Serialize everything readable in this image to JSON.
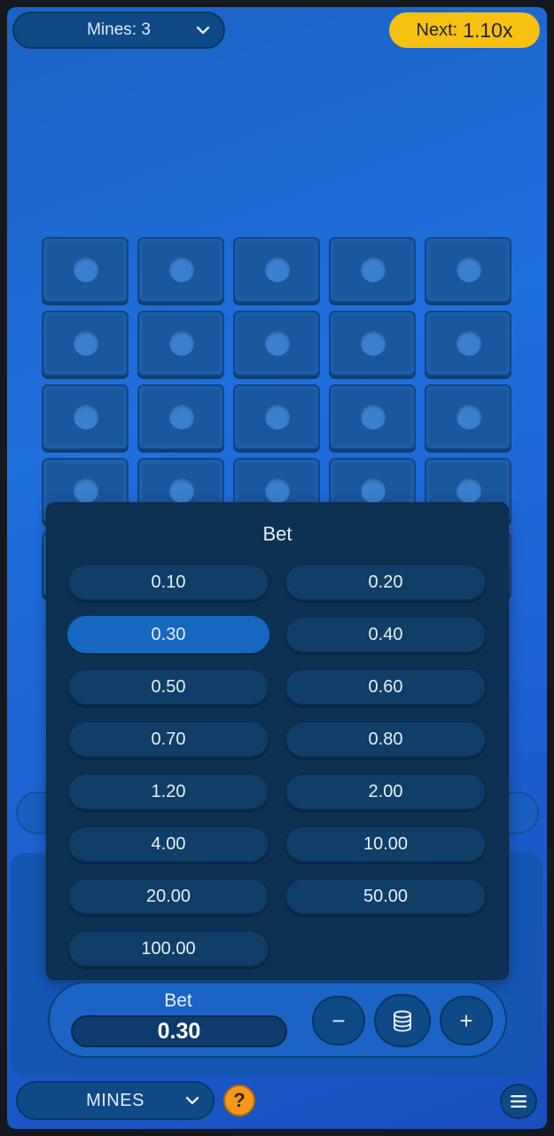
{
  "topbar": {
    "mines_label": "Mines: 3",
    "next_label": "Next:",
    "next_value": "1.10x"
  },
  "grid": {
    "rows": 5,
    "cols": 5
  },
  "bet_modal": {
    "title": "Bet",
    "options": [
      "0.10",
      "0.20",
      "0.30",
      "0.40",
      "0.50",
      "0.60",
      "0.70",
      "0.80",
      "1.20",
      "2.00",
      "4.00",
      "10.00",
      "20.00",
      "50.00",
      "100.00"
    ],
    "selected": "0.30"
  },
  "bet_bar": {
    "label": "Bet",
    "value": "0.30",
    "minus_label": "−",
    "plus_label": "+",
    "coins_icon": "coins-stack-icon"
  },
  "bottombar": {
    "game_label": "MINES",
    "help_label": "?",
    "menu_icon": "hamburger-icon"
  },
  "colors": {
    "accent_yellow": "#f6c110",
    "help_orange": "#f39a1c",
    "selected_option": "#1667c0",
    "modal_bg": "#0d3152"
  }
}
